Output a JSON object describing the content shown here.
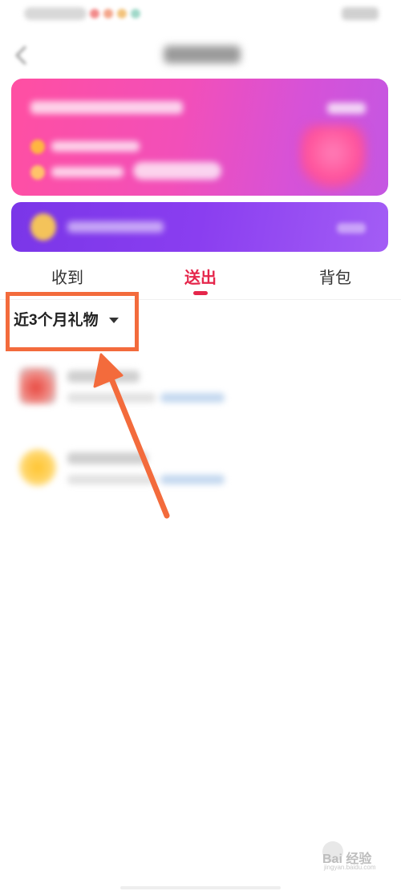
{
  "tabs": [
    {
      "label": "收到",
      "active": false
    },
    {
      "label": "送出",
      "active": true
    },
    {
      "label": "背包",
      "active": false
    }
  ],
  "filter": {
    "label": "近3个月礼物"
  },
  "watermark": {
    "text": "Bai 经验",
    "sub": "jingyan.baidu.com"
  },
  "colors": {
    "accent": "#e5264b",
    "highlight": "#f36b3c",
    "card_pink": "#ff4fa2",
    "card_purple": "#7a36e8"
  }
}
